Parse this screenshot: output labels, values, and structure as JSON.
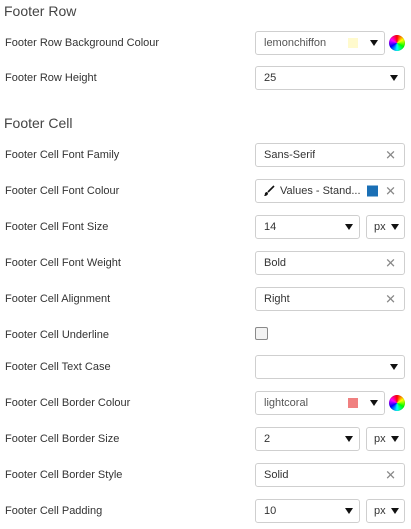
{
  "footer_row": {
    "title": "Footer Row",
    "bg_colour": {
      "label": "Footer Row Background Colour",
      "value": "lemonchiffon",
      "swatch": "#fffacd"
    },
    "height": {
      "label": "Footer Row Height",
      "value": "25"
    }
  },
  "footer_cell": {
    "title": "Footer Cell",
    "font_family": {
      "label": "Footer Cell Font Family",
      "value": "Sans-Serif"
    },
    "font_colour": {
      "label": "Footer Cell Font Colour",
      "value": "Values - Stand...",
      "swatch": "#1a6fb5",
      "icon": "brush-icon"
    },
    "font_size": {
      "label": "Footer Cell Font Size",
      "value": "14",
      "unit": "px"
    },
    "font_weight": {
      "label": "Footer Cell Font Weight",
      "value": "Bold"
    },
    "alignment": {
      "label": "Footer Cell Alignment",
      "value": "Right"
    },
    "underline": {
      "label": "Footer Cell Underline",
      "checked": false
    },
    "text_case": {
      "label": "Footer Cell Text Case",
      "value": ""
    },
    "border_colour": {
      "label": "Footer Cell Border Colour",
      "value": "lightcoral",
      "swatch": "#f08080"
    },
    "border_size": {
      "label": "Footer Cell Border Size",
      "value": "2",
      "unit": "px"
    },
    "border_style": {
      "label": "Footer Cell Border Style",
      "value": "Solid"
    },
    "padding": {
      "label": "Footer Cell Padding",
      "value": "10",
      "unit": "px"
    }
  }
}
